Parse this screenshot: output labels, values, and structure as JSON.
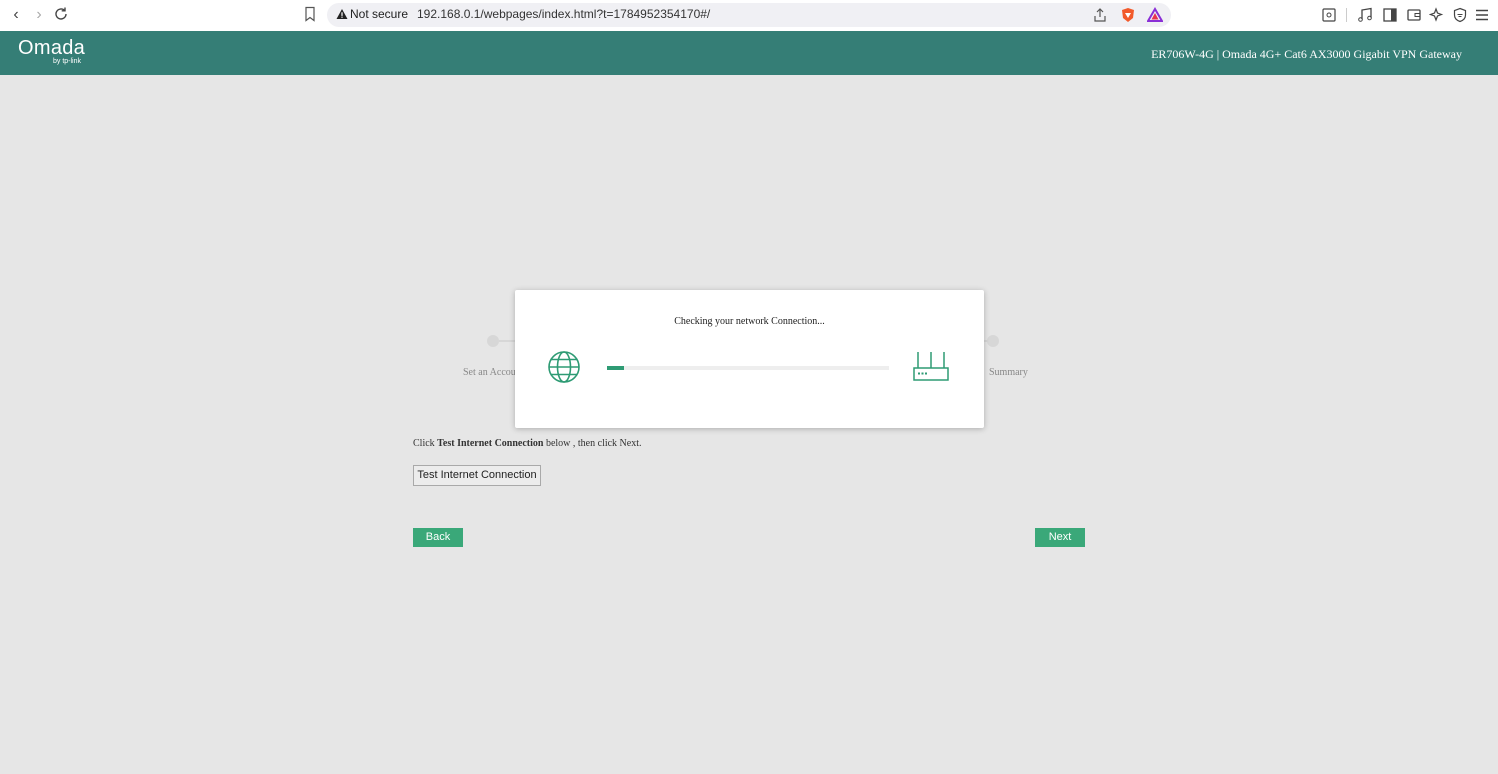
{
  "browser": {
    "security_label": "Not secure",
    "url": "192.168.0.1/webpages/index.html?t=1784952354170#/"
  },
  "header": {
    "logo": "Omada",
    "logo_sub": "by tp-link",
    "device_info": "ER706W-4G  |  Omada 4G+ Cat6 AX3000 Gigabit VPN Gateway"
  },
  "wizard": {
    "step_first_label": "Set an Accou",
    "step_last_label": "Summary",
    "instruction_prefix": "Click ",
    "instruction_bold": "Test Internet Connection",
    "instruction_suffix": " below , then click Next.",
    "test_button": "Test Internet Connection",
    "back_button": "Back",
    "next_button": "Next"
  },
  "modal": {
    "title": "Checking your network Connection...",
    "progress": 0.06
  },
  "colors": {
    "header_bg": "#357e76",
    "accent_green": "#3aa879",
    "progress_green": "#2e9b74",
    "page_bg": "#e6e6e6"
  }
}
